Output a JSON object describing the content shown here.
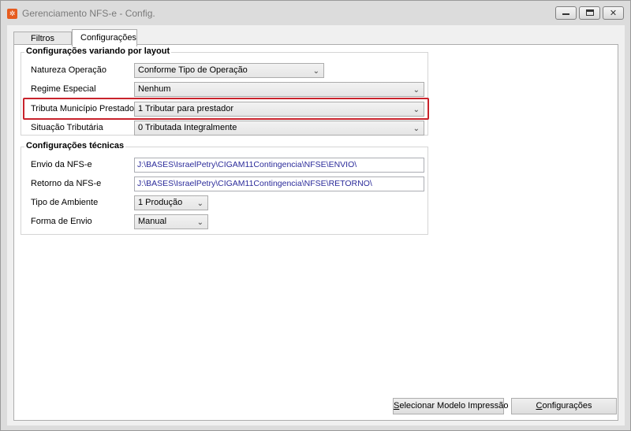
{
  "window": {
    "title": "Gerenciamento NFS-e - Config.",
    "icon": "app-logo-icon",
    "accent": "#e65c1f"
  },
  "tabs": [
    {
      "label": "Filtros",
      "active": false
    },
    {
      "label": "Configurações",
      "active": true
    }
  ],
  "layout_group": {
    "title": "Configurações variando por layout",
    "rows": [
      {
        "label": "Natureza Operação",
        "value": "Conforme Tipo de Operação"
      },
      {
        "label": "Regime Especial",
        "value": "Nenhum"
      },
      {
        "label": "Tributa Município Prestador",
        "value": "1 Tributar para prestador"
      },
      {
        "label": "Situação Tributária",
        "value": "0  Tributada Integralmente"
      }
    ],
    "highlight_color": "#c8232c"
  },
  "tech_group": {
    "title": "Configurações técnicas",
    "envio_label": "Envio da NFS-e",
    "envio_value": "J:\\BASES\\IsraelPetry\\CIGAM11Contingencia\\NFSE\\ENVIO\\",
    "retorno_label": "Retorno da NFS-e",
    "retorno_value": "J:\\BASES\\IsraelPetry\\CIGAM11Contingencia\\NFSE\\RETORNO\\",
    "ambiente_label": "Tipo de Ambiente",
    "ambiente_value": "1 Produção",
    "forma_label": "Forma de Envio",
    "forma_value": "Manual"
  },
  "buttons": {
    "modelo_first": "S",
    "modelo_rest": "elecionar Modelo Impressão",
    "config_first": "C",
    "config_rest": "onfigurações"
  }
}
